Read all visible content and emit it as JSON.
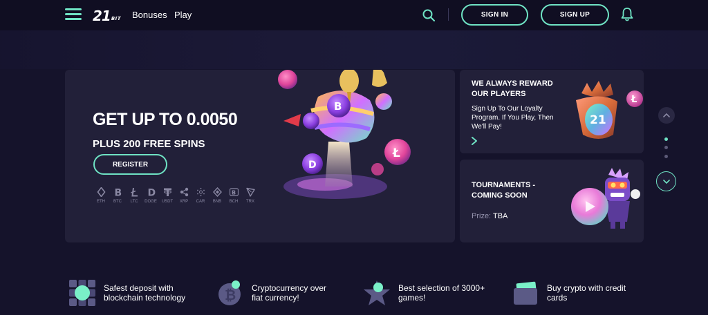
{
  "header": {
    "logo_number": "21",
    "logo_text": "BIT",
    "nav": [
      {
        "label": "Bonuses"
      },
      {
        "label": "Play"
      }
    ],
    "sign_in_label": "SIGN IN",
    "sign_up_label": "SIGN UP"
  },
  "banner": {
    "title": "GET UP TO 0.0050",
    "subtitle": "PLUS 200 FREE SPINS",
    "register_label": "REGISTER",
    "coins": [
      {
        "label": "ETH",
        "icon": "eth-icon"
      },
      {
        "label": "BTC",
        "icon": "btc-icon"
      },
      {
        "label": "LTC",
        "icon": "ltc-icon"
      },
      {
        "label": "DOGE",
        "icon": "doge-icon"
      },
      {
        "label": "USDT",
        "icon": "usdt-icon"
      },
      {
        "label": "XRP",
        "icon": "xrp-icon"
      },
      {
        "label": "CAR",
        "icon": "cardano-icon"
      },
      {
        "label": "BNB",
        "icon": "bnb-icon"
      },
      {
        "label": "BCH",
        "icon": "bch-icon"
      },
      {
        "label": "TRX",
        "icon": "trx-icon"
      }
    ]
  },
  "reward_card": {
    "title": "WE ALWAYS REWARD OUR PLAYERS",
    "text": "Sign Up To Our Loyalty Program. If You Play, Then We'll Pay!",
    "badge": "21"
  },
  "tournament_card": {
    "title": "TOURNAMENTS - COMING SOON",
    "prize_label": "Prize:",
    "prize_value": "TBA"
  },
  "slider": {
    "dots": 3,
    "active_dot": 1
  },
  "features": [
    {
      "text": "Safest deposit with blockchain technology",
      "icon": "blockchain-icon"
    },
    {
      "text": "Cryptocurrency over fiat currency!",
      "icon": "bitcoin-coin-icon"
    },
    {
      "text": "Best selection of 3000+ games!",
      "icon": "star-icon"
    },
    {
      "text": "Buy crypto with credit cards",
      "icon": "wallet-card-icon"
    }
  ],
  "colors": {
    "accent": "#6fe3c4",
    "background": "#15132b",
    "card": "#222039",
    "header": "#100e22"
  }
}
